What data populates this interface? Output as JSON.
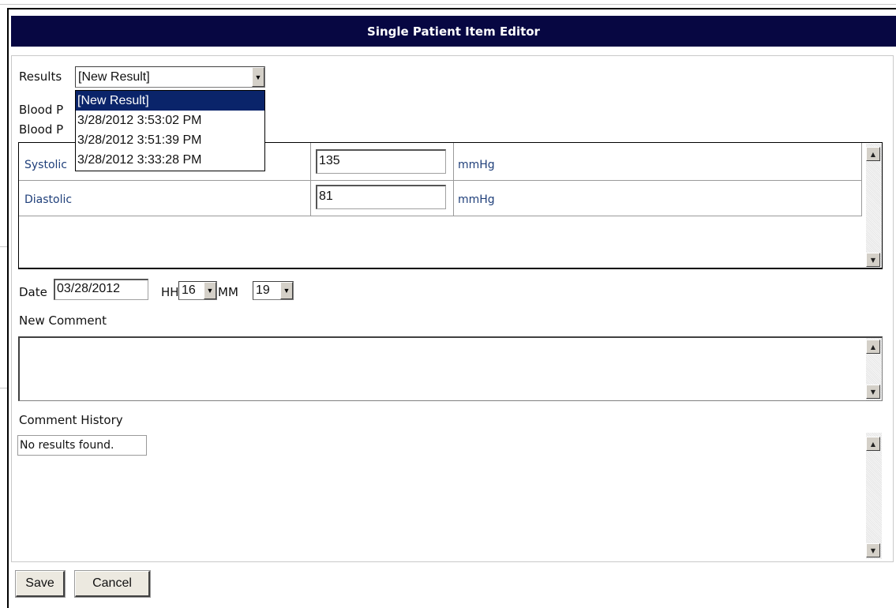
{
  "dialog": {
    "title": "Single Patient Item Editor"
  },
  "results": {
    "label": "Results",
    "selected": "[New Result]",
    "options": [
      "[New Result]",
      "3/28/2012 3:53:02 PM",
      "3/28/2012 3:51:39 PM",
      "3/28/2012 3:33:28 PM"
    ]
  },
  "blood_lines": [
    "Blood P",
    "Blood P"
  ],
  "measurements": [
    {
      "label": "Systolic",
      "value": "135",
      "unit": "mmHg"
    },
    {
      "label": "Diastolic",
      "value": "81",
      "unit": "mmHg"
    }
  ],
  "date_row": {
    "date_label": "Date",
    "date_value": "03/28/2012",
    "hh_label": "HH",
    "hh_value": "16",
    "mm_label": "MM",
    "mm_value": "19"
  },
  "new_comment": {
    "label": "New Comment",
    "value": ""
  },
  "comment_history": {
    "label": "Comment History",
    "empty_text": "No results found."
  },
  "buttons": {
    "save": "Save",
    "cancel": "Cancel"
  },
  "colors": {
    "title_bar": "#070742",
    "selected_option": "#0a246a",
    "field_label": "#1f3f7a"
  },
  "icons": {
    "dropdown_arrow": "▼",
    "scroll_up": "▲",
    "scroll_down": "▼"
  }
}
